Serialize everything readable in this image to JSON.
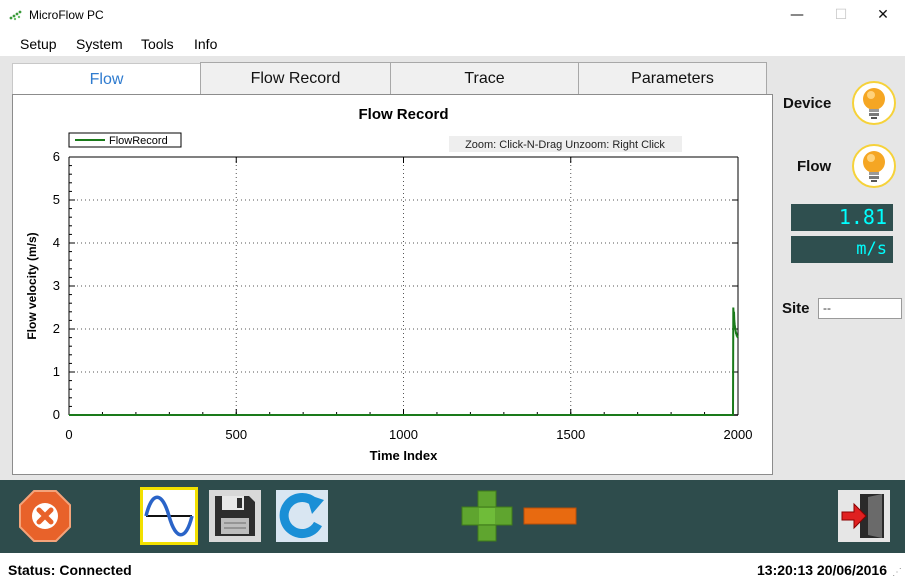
{
  "window": {
    "title": "MicroFlow PC",
    "minimize_glyph": "—",
    "maximize_glyph": "☐",
    "close_glyph": "✕"
  },
  "menu": [
    "Setup",
    "System",
    "Tools",
    "Info"
  ],
  "tabs": [
    {
      "label": "Flow",
      "active": true
    },
    {
      "label": "Flow Record",
      "active": false
    },
    {
      "label": "Trace",
      "active": false
    },
    {
      "label": "Parameters",
      "active": false
    }
  ],
  "chart_hint": {
    "zoom": "Zoom: Click-N-Drag",
    "unzoom": "Unzoom: Right Click"
  },
  "chart_data": {
    "type": "line",
    "title": "Flow Record",
    "xlabel": "Time Index",
    "ylabel": "Flow velocity (m/s)",
    "xlim": [
      0,
      2000
    ],
    "ylim": [
      0,
      6
    ],
    "xticks": [
      0,
      500,
      1000,
      1500,
      2000
    ],
    "yticks": [
      0,
      1,
      2,
      3,
      4,
      5,
      6
    ],
    "grid": true,
    "legend_position": "top-left",
    "series": [
      {
        "name": "FlowRecord",
        "color": "#1a7a1a",
        "x": [
          0,
          1985,
          1986,
          1987,
          1988,
          1989,
          1990,
          1991,
          1992,
          1993,
          1994,
          1995,
          1996,
          1997,
          1998,
          1999,
          2000
        ],
        "y": [
          0,
          0,
          2.5,
          2.3,
          2.4,
          2.2,
          2.1,
          2.05,
          2.0,
          1.95,
          1.9,
          1.9,
          1.85,
          1.85,
          1.82,
          1.81,
          1.81
        ]
      }
    ]
  },
  "status_panel": {
    "device_label": "Device",
    "flow_label": "Flow",
    "velocity_value": "1.81",
    "velocity_unit": "m/s",
    "site_label": "Site",
    "site_value": "--"
  },
  "toolbar": {
    "buttons": [
      "stop-icon",
      "waveform-icon",
      "save-icon",
      "refresh-icon",
      "plus-icon",
      "minus-icon",
      "exit-icon"
    ]
  },
  "status_bar": {
    "status": "Status: Connected",
    "datetime": "13:20:13 20/06/2016"
  },
  "colors": {
    "toolbar_bg": "#2e4c4c",
    "readout_bg": "#2f4f4f",
    "readout_text": "#00ffff",
    "active_tab_text": "#2e7bcf",
    "series_color": "#1a7a1a"
  }
}
